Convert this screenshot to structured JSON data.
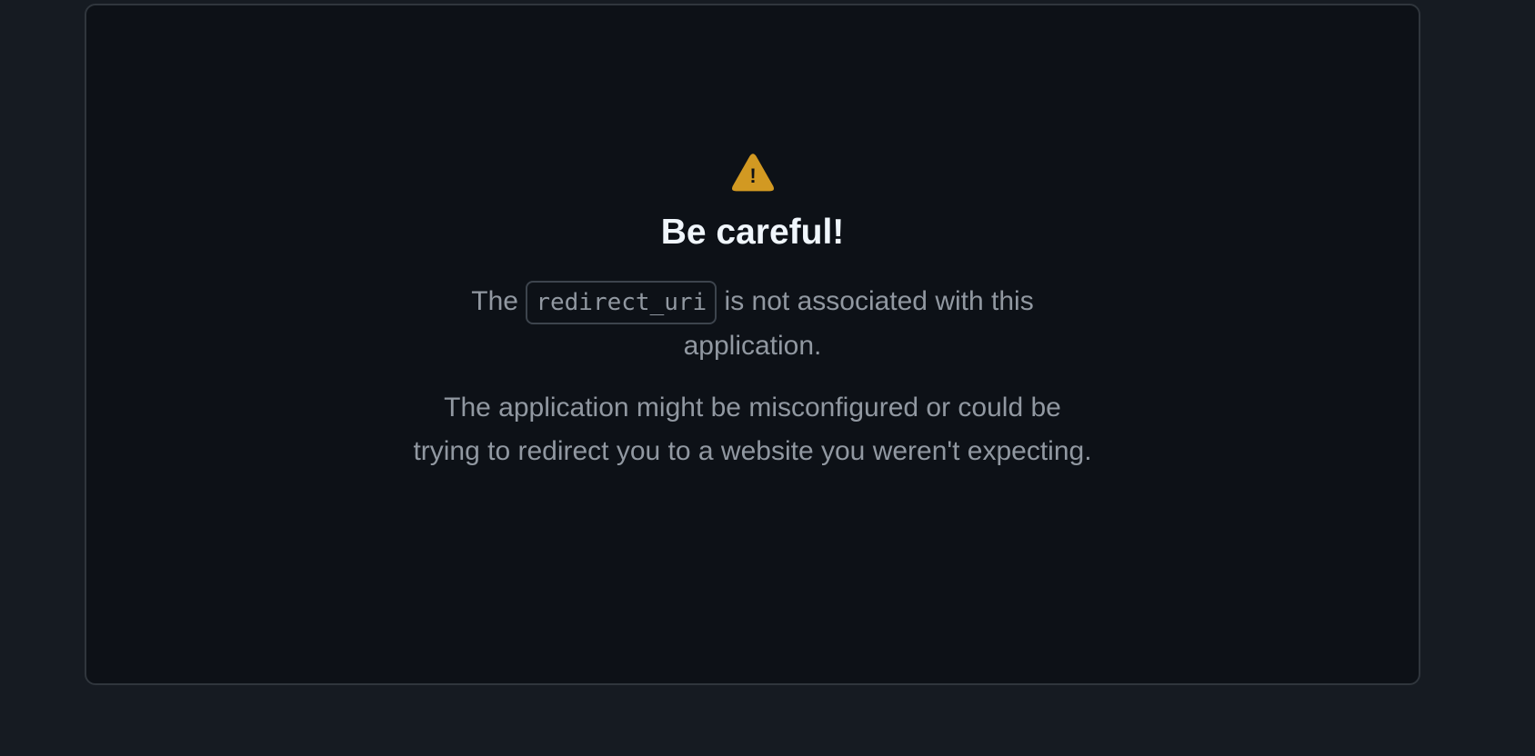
{
  "colors": {
    "page_background": "#161b22",
    "card_background": "#0d1117",
    "card_border": "#30363d",
    "warning_icon": "#d29922",
    "title_text": "#f0f6fc",
    "body_text": "#9198a1"
  },
  "alert": {
    "icon": "alert-triangle-icon",
    "icon_glyph": "!",
    "title": "Be careful!",
    "message_prefix": "The",
    "message_code": "redirect_uri",
    "message_suffix": "is not associated with this application.",
    "detail": "The application might be misconfigured or could be trying to redirect you to a website you weren't expecting."
  }
}
